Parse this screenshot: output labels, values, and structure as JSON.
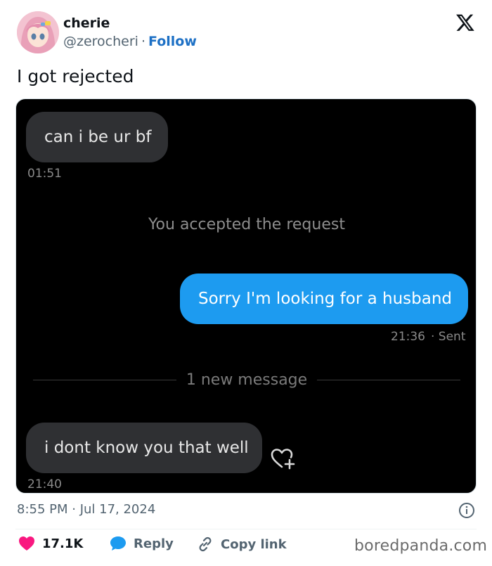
{
  "author": {
    "name": "cherie",
    "handle": "@zerocheri",
    "separator": "·",
    "follow_label": "Follow"
  },
  "tweet": {
    "text": "I got rejected",
    "timestamp": "8:55 PM · Jul 17, 2024"
  },
  "screenshot": {
    "messages": [
      {
        "text": "can i be ur bf",
        "time": "01:51",
        "direction": "incoming"
      },
      {
        "text": "Sorry I'm looking for a husband",
        "time": "21:36",
        "status": "· Sent",
        "direction": "outgoing"
      },
      {
        "text": "i dont know you that well",
        "time": "21:40",
        "direction": "incoming"
      }
    ],
    "system_notice": "You accepted the request",
    "new_message_divider": "1 new message"
  },
  "actions": {
    "likes": "17.1K",
    "reply_label": "Reply",
    "copy_link_label": "Copy link"
  },
  "watermark": "boredpanda.com",
  "colors": {
    "follow": "#1d70c5",
    "outgoing_bubble": "#1d9bf0",
    "incoming_bubble": "#2f3033",
    "like_heart": "#f91880",
    "reply_icon": "#1d9bf0"
  },
  "icons": [
    "x-logo-icon",
    "heart-plus-icon",
    "info-icon",
    "heart-icon",
    "reply-bubble-icon",
    "link-icon"
  ]
}
